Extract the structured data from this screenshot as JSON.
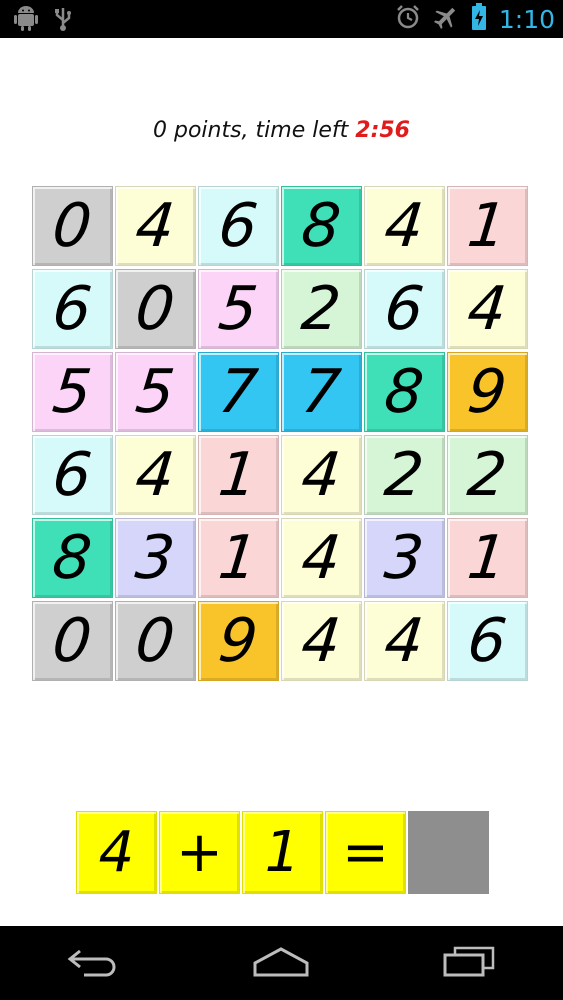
{
  "status_bar": {
    "time": "1:10",
    "icons": [
      "android-debug-icon",
      "usb-icon",
      "alarm-icon",
      "airplane-mode-icon",
      "battery-charging-icon"
    ]
  },
  "score": {
    "prefix": "0 points, time left ",
    "time_left": "2:56"
  },
  "grid": {
    "rows": [
      [
        {
          "v": "0",
          "c": "#cfcfcf"
        },
        {
          "v": "4",
          "c": "#fdfdd6"
        },
        {
          "v": "6",
          "c": "#d6fafa"
        },
        {
          "v": "8",
          "c": "#3fe0b8"
        },
        {
          "v": "4",
          "c": "#fdfdd6"
        },
        {
          "v": "1",
          "c": "#fbd6d6"
        }
      ],
      [
        {
          "v": "6",
          "c": "#d6fafa"
        },
        {
          "v": "0",
          "c": "#cfcfcf"
        },
        {
          "v": "5",
          "c": "#fbd4f8"
        },
        {
          "v": "2",
          "c": "#d6f5d6"
        },
        {
          "v": "6",
          "c": "#d6fafa"
        },
        {
          "v": "4",
          "c": "#fdfdd6"
        }
      ],
      [
        {
          "v": "5",
          "c": "#fbd4f8"
        },
        {
          "v": "5",
          "c": "#fbd4f8"
        },
        {
          "v": "7",
          "c": "#33c6f2"
        },
        {
          "v": "7",
          "c": "#33c6f2"
        },
        {
          "v": "8",
          "c": "#3fe0b8"
        },
        {
          "v": "9",
          "c": "#f9c42a"
        }
      ],
      [
        {
          "v": "6",
          "c": "#d6fafa"
        },
        {
          "v": "4",
          "c": "#fdfdd6"
        },
        {
          "v": "1",
          "c": "#fbd6d6"
        },
        {
          "v": "4",
          "c": "#fdfdd6"
        },
        {
          "v": "2",
          "c": "#d6f5d6"
        },
        {
          "v": "2",
          "c": "#d6f5d6"
        }
      ],
      [
        {
          "v": "8",
          "c": "#3fe0b8"
        },
        {
          "v": "3",
          "c": "#d6d6fb"
        },
        {
          "v": "1",
          "c": "#fbd6d6"
        },
        {
          "v": "4",
          "c": "#fdfdd6"
        },
        {
          "v": "3",
          "c": "#d6d6fb"
        },
        {
          "v": "1",
          "c": "#fbd6d6"
        }
      ],
      [
        {
          "v": "0",
          "c": "#cfcfcf"
        },
        {
          "v": "0",
          "c": "#cfcfcf"
        },
        {
          "v": "9",
          "c": "#f9c42a"
        },
        {
          "v": "4",
          "c": "#fdfdd6"
        },
        {
          "v": "4",
          "c": "#fdfdd6"
        },
        {
          "v": "6",
          "c": "#d6fafa"
        }
      ]
    ]
  },
  "equation": {
    "cells": [
      "4",
      "+",
      "1",
      "="
    ],
    "answer": ""
  },
  "colors": {
    "accent_time": "#33b5e5",
    "time_left": "#e01b1b",
    "equation_bg": "#ffff00",
    "answer_bg": "#8e8e8e"
  },
  "nav_bar": {
    "icons": [
      "back-icon",
      "home-icon",
      "recent-apps-icon"
    ]
  }
}
